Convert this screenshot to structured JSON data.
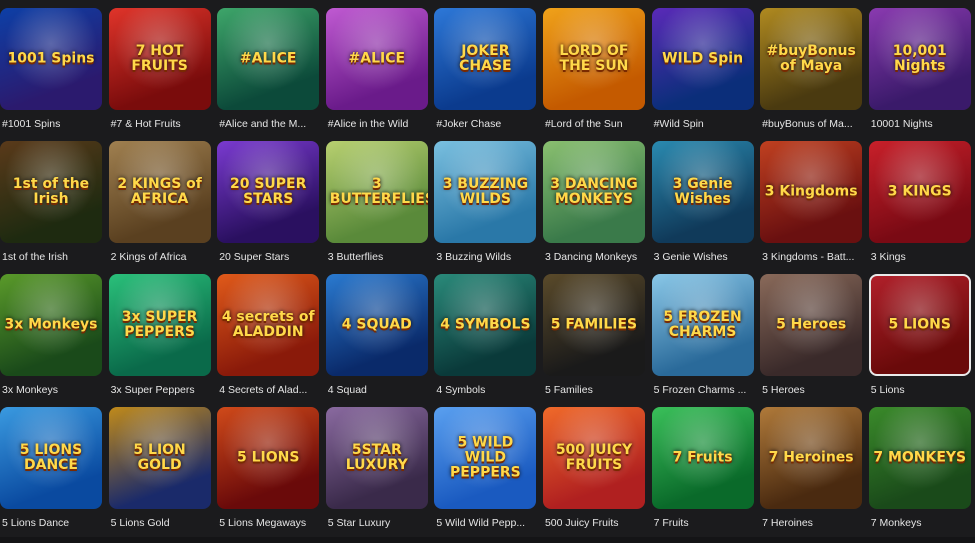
{
  "games": [
    {
      "title": "#1001 Spins",
      "art": "1001 Spins",
      "c1": "#2b1a6e",
      "c2": "#0d3fa6"
    },
    {
      "title": "#7 & Hot Fruits",
      "art": "7 HOT FRUITS",
      "c1": "#7a0c0c",
      "c2": "#e0342a"
    },
    {
      "title": "#Alice and the M...",
      "art": "#ALICE",
      "c1": "#0c4a3a",
      "c2": "#3ea66a"
    },
    {
      "title": "#Alice in the Wild",
      "art": "#ALICE",
      "c1": "#6a1b8a",
      "c2": "#c05ad2"
    },
    {
      "title": "#Joker Chase",
      "art": "JOKER CHASE",
      "c1": "#0b3b8e",
      "c2": "#2d78d8"
    },
    {
      "title": "#Lord of the Sun",
      "art": "LORD OF THE SUN",
      "c1": "#c45a00",
      "c2": "#f0a21a"
    },
    {
      "title": "#Wild Spin",
      "art": "WILD Spin",
      "c1": "#0b2e7a",
      "c2": "#5a2ab8"
    },
    {
      "title": "#buyBonus of Ma...",
      "art": "#buyBonus of Maya",
      "c1": "#4a3a10",
      "c2": "#b08a20"
    },
    {
      "title": "10001 Nights",
      "art": "10,001 Nights",
      "c1": "#3a1a6a",
      "c2": "#8a3ab0"
    },
    {
      "title": "1st of the Irish",
      "art": "1st of the Irish",
      "c1": "#1e2a10",
      "c2": "#5a3a1a"
    },
    {
      "title": "2 Kings of Africa",
      "art": "2 KINGS of AFRICA",
      "c1": "#5a4020",
      "c2": "#a08050"
    },
    {
      "title": "20 Super Stars",
      "art": "20 SUPER STARS",
      "c1": "#2a1060",
      "c2": "#7a3ad0"
    },
    {
      "title": "3 Butterflies",
      "art": "3 BUTTERFLIES",
      "c1": "#5a8a3a",
      "c2": "#b8d070"
    },
    {
      "title": "3 Buzzing Wilds",
      "art": "3 BUZZING WILDS",
      "c1": "#2a78a8",
      "c2": "#7ac0e0"
    },
    {
      "title": "3 Dancing Monkeys",
      "art": "3 DANCING MONKEYS",
      "c1": "#3a7a4a",
      "c2": "#8ac070"
    },
    {
      "title": "3 Genie Wishes",
      "art": "3 Genie Wishes",
      "c1": "#103a5a",
      "c2": "#2a8ab0"
    },
    {
      "title": "3 Kingdoms - Batt...",
      "art": "3 Kingdoms",
      "c1": "#6a1010",
      "c2": "#c04020"
    },
    {
      "title": "3 Kings",
      "art": "3 KINGS",
      "c1": "#7a0a14",
      "c2": "#c8202a"
    },
    {
      "title": "3x Monkeys",
      "art": "3x Monkeys",
      "c1": "#1a4a1a",
      "c2": "#5a9a2a"
    },
    {
      "title": "3x Super Peppers",
      "art": "3x SUPER PEPPERS",
      "c1": "#0a6a4a",
      "c2": "#2ac07a"
    },
    {
      "title": "4 Secrets of Alad...",
      "art": "4 secrets of ALADDIN",
      "c1": "#8a1a0a",
      "c2": "#e05a1a"
    },
    {
      "title": "4 Squad",
      "art": "4 SQUAD",
      "c1": "#0a2a6a",
      "c2": "#2a7ad0"
    },
    {
      "title": "4 Symbols",
      "art": "4 SYMBOLS",
      "c1": "#0a3a3a",
      "c2": "#2a8a7a"
    },
    {
      "title": "5 Families",
      "art": "5 FAMILIES",
      "c1": "#1a1a1a",
      "c2": "#5a4a2a"
    },
    {
      "title": "5 Frozen Charms ...",
      "art": "5 FROZEN CHARMS",
      "c1": "#2a6a9a",
      "c2": "#8ac8e8"
    },
    {
      "title": "5 Heroes",
      "art": "5 Heroes",
      "c1": "#3a2a2a",
      "c2": "#8a6a5a"
    },
    {
      "title": "5 Lions",
      "art": "5 LIONS",
      "c1": "#6a0a0a",
      "c2": "#b0202a"
    },
    {
      "title": "5 Lions Dance",
      "art": "5 LIONS DANCE",
      "c1": "#0a4aa0",
      "c2": "#3a9ae0"
    },
    {
      "title": "5 Lions Gold",
      "art": "5 LION GOLD",
      "c1": "#1a2a6a",
      "c2": "#c08a1a"
    },
    {
      "title": "5 Lions Megaways",
      "art": "5 LIONS",
      "c1": "#6a0a0a",
      "c2": "#d04a1a"
    },
    {
      "title": "5 Star Luxury",
      "art": "5STAR LUXURY",
      "c1": "#3a2a4a",
      "c2": "#8a6aa0"
    },
    {
      "title": "5 Wild Wild Pepp...",
      "art": "5 WILD WILD PEPPERS",
      "c1": "#1a5ac0",
      "c2": "#5aa0f0"
    },
    {
      "title": "500 Juicy Fruits",
      "art": "500 JUICY FRUITS",
      "c1": "#b02020",
      "c2": "#f06a2a"
    },
    {
      "title": "7 Fruits",
      "art": "7 Fruits",
      "c1": "#0a6a2a",
      "c2": "#3ac05a"
    },
    {
      "title": "7 Heroines",
      "art": "7 Heroines",
      "c1": "#4a2a10",
      "c2": "#b07a3a"
    },
    {
      "title": "7 Monkeys",
      "art": "7 MONKEYS",
      "c1": "#1a4a1a",
      "c2": "#3a8a2a"
    }
  ],
  "selected_index": 26
}
